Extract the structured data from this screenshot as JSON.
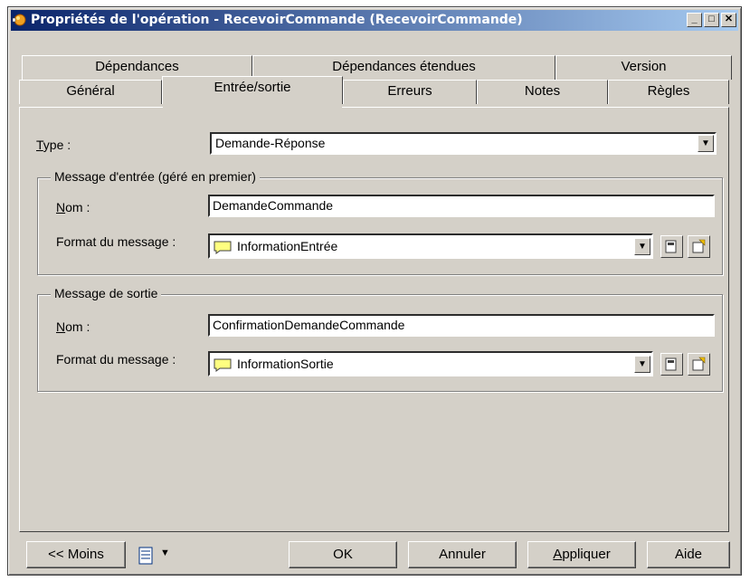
{
  "window": {
    "title": "Propriétés de l'opération - RecevoirCommande (RecevoirCommande)",
    "min_glyph": "_",
    "max_glyph": "□",
    "close_glyph": "✕"
  },
  "tabs_row1": [
    {
      "label": "Dépendances"
    },
    {
      "label": "Dépendances étendues"
    },
    {
      "label": "Version"
    }
  ],
  "tabs_row2": [
    {
      "label": "Général"
    },
    {
      "label": "Entrée/sortie",
      "active": true
    },
    {
      "label": "Erreurs"
    },
    {
      "label": "Notes"
    },
    {
      "label": "Règles"
    }
  ],
  "type": {
    "label_first": "T",
    "label_rest": "ype :",
    "value": "Demande-Réponse"
  },
  "input_message": {
    "title": "Message d'entrée (géré en premier)",
    "name_label_first": "N",
    "name_label_rest": "om :",
    "name_value": "DemandeCommande",
    "format_label": "Format du message :",
    "format_value": "InformationEntrée"
  },
  "output_message": {
    "title": "Message de sortie",
    "name_label_first": "N",
    "name_label_rest": "om :",
    "name_value": "ConfirmationDemandeCommande",
    "format_label": "Format du message :",
    "format_value": "InformationSortie"
  },
  "footer": {
    "less_label": "<< Moins",
    "ok_label": "OK",
    "cancel_label": "Annuler",
    "apply_label_first": "A",
    "apply_label_rest": "ppliquer",
    "help_label": "Aide"
  },
  "icons": {
    "title": "operation-icon",
    "message_format": "message-format-icon",
    "browse": "properties-icon",
    "create": "create-icon",
    "menu": "menu-list-icon"
  },
  "colors": {
    "face": "#d4d0c8",
    "title_start": "#0a246a",
    "title_end": "#a6caf0",
    "message_icon": "#ffff80"
  }
}
